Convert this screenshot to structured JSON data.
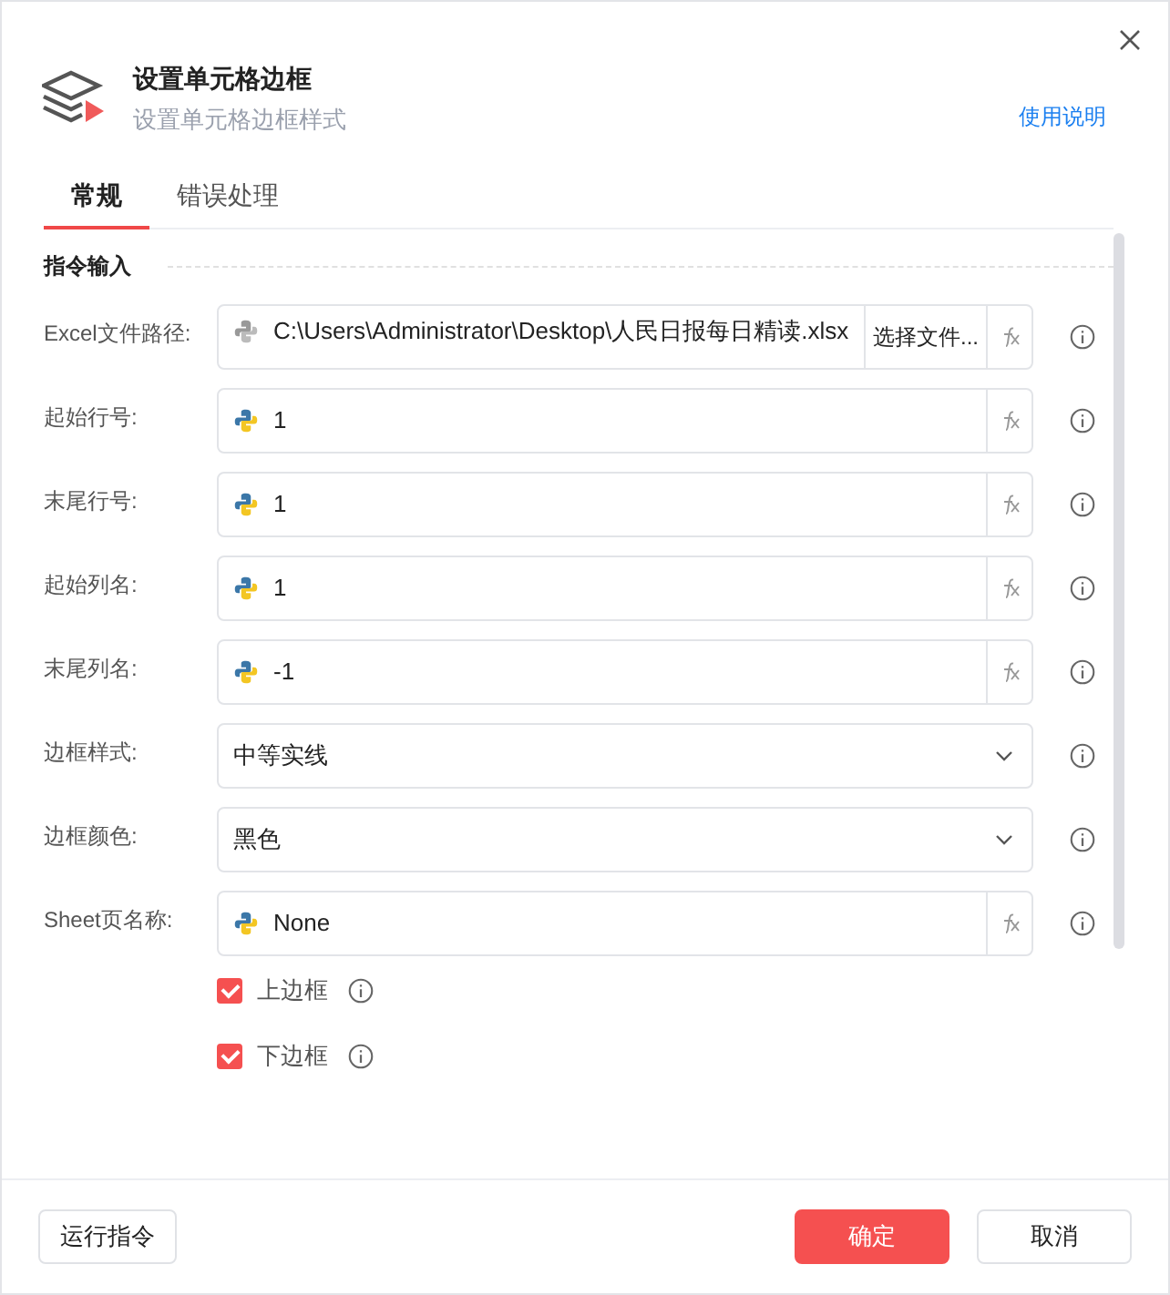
{
  "header": {
    "title": "设置单元格边框",
    "subtitle": "设置单元格边框样式",
    "help_link": "使用说明"
  },
  "tabs": [
    {
      "label": "常规",
      "selected": true
    },
    {
      "label": "错误处理",
      "selected": false
    }
  ],
  "section": {
    "title": "指令输入"
  },
  "fields": [
    {
      "kind": "file",
      "label": "Excel文件路径:",
      "value": "C:\\Users\\Administrator\\Desktop\\人民日报每日精读.xlsx",
      "button": "选择文件..."
    },
    {
      "kind": "expression",
      "label": "起始行号:",
      "value": "1"
    },
    {
      "kind": "expression",
      "label": "末尾行号:",
      "value": "1"
    },
    {
      "kind": "expression",
      "label": "起始列名:",
      "value": "1"
    },
    {
      "kind": "expression",
      "label": "末尾列名:",
      "value": "-1"
    },
    {
      "kind": "select",
      "label": "边框样式:",
      "value": "中等实线"
    },
    {
      "kind": "select",
      "label": "边框颜色:",
      "value": "黑色"
    },
    {
      "kind": "expression",
      "label": "Sheet页名称:",
      "value": "None"
    }
  ],
  "checkboxes": [
    {
      "label": "上边框",
      "checked": true
    },
    {
      "label": "下边框",
      "checked": true
    }
  ],
  "footer": {
    "run_button": "运行指令",
    "ok_button": "确定",
    "cancel_button": "取消"
  }
}
